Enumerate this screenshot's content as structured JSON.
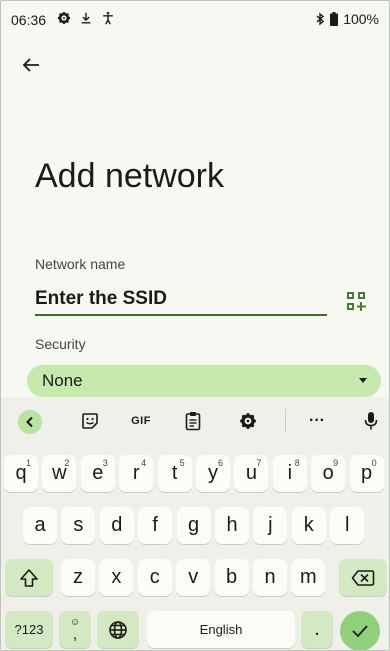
{
  "status_bar": {
    "time": "06:36",
    "battery": "100%"
  },
  "page": {
    "title": "Add network",
    "network_name_label": "Network name",
    "ssid_placeholder": "Enter the SSID",
    "security_label": "Security",
    "security_value": "None"
  },
  "keyboard": {
    "toolbar": {
      "gif": "GIF",
      "more": "···"
    },
    "row1": [
      {
        "k": "q",
        "h": "1"
      },
      {
        "k": "w",
        "h": "2"
      },
      {
        "k": "e",
        "h": "3"
      },
      {
        "k": "r",
        "h": "4"
      },
      {
        "k": "t",
        "h": "5"
      },
      {
        "k": "y",
        "h": "6"
      },
      {
        "k": "u",
        "h": "7"
      },
      {
        "k": "i",
        "h": "8"
      },
      {
        "k": "o",
        "h": "9"
      },
      {
        "k": "p",
        "h": "0"
      }
    ],
    "row2": [
      "a",
      "s",
      "d",
      "f",
      "g",
      "h",
      "j",
      "k",
      "l"
    ],
    "row3": [
      "z",
      "x",
      "c",
      "v",
      "b",
      "n",
      "m"
    ],
    "symbols_key": "?123",
    "comma": ",",
    "space_label": "English",
    "period": "."
  },
  "colors": {
    "accent": "#3e6a2c",
    "select_bg": "#c6eaac",
    "enter_bg": "#8fd17a",
    "background": "#f6f8f1"
  },
  "icons": [
    "settings-icon",
    "download-icon",
    "accessibility-icon",
    "bluetooth-icon",
    "battery-icon",
    "back-arrow-icon",
    "qr-code-icon",
    "emoji-icon",
    "clipboard-icon",
    "mic-icon",
    "globe-icon",
    "shift-icon",
    "backspace-icon",
    "check-icon"
  ]
}
